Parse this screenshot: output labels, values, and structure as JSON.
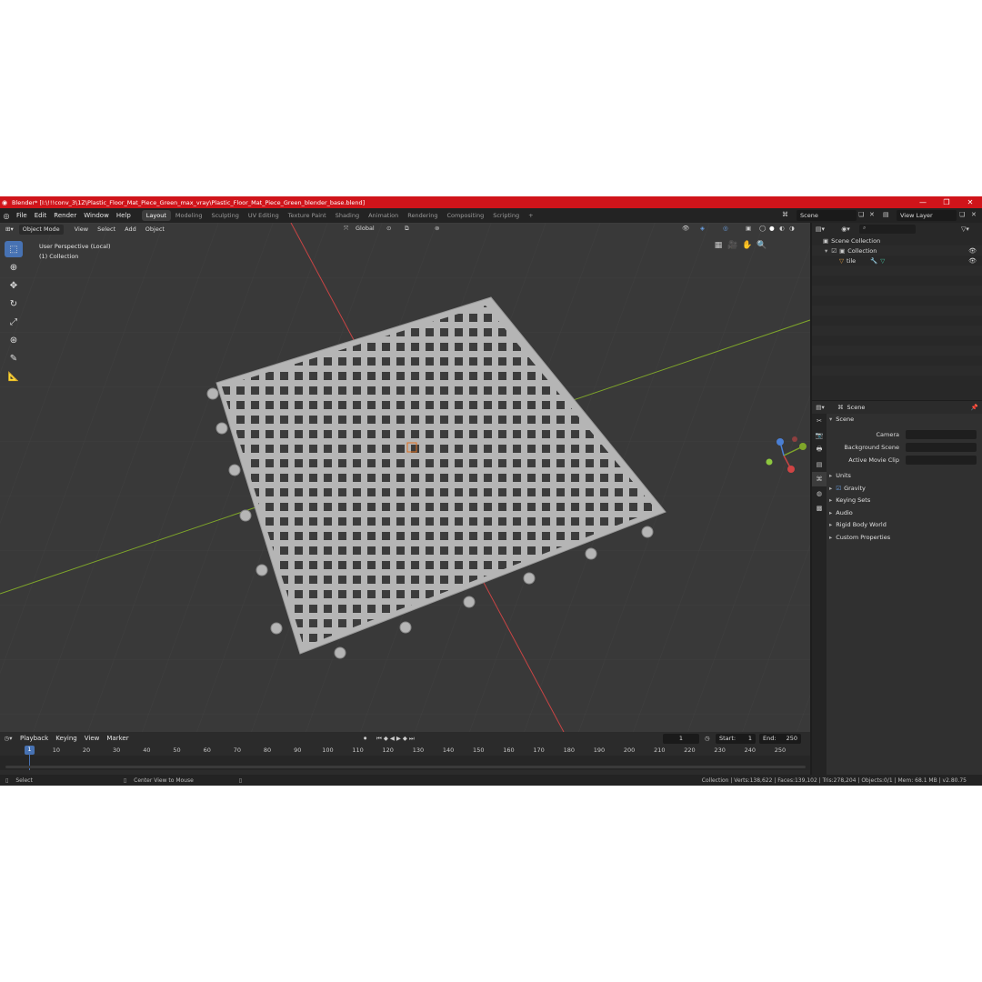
{
  "titlebar": {
    "title": "Blender* [I:\\!!!conv_3\\1Z\\Plastic_Floor_Mat_Piece_Green_max_vray\\Plastic_Floor_Mat_Piece_Green_blender_base.blend]",
    "minimize": "—",
    "maximize": "❐",
    "close": "✕"
  },
  "menu": [
    "File",
    "Edit",
    "Render",
    "Window",
    "Help"
  ],
  "workspaces": [
    "Layout",
    "Modeling",
    "Sculpting",
    "UV Editing",
    "Texture Paint",
    "Shading",
    "Animation",
    "Rendering",
    "Compositing",
    "Scripting"
  ],
  "add_workspace": "+",
  "scene_name": "Scene",
  "view_layer": "View Layer",
  "viewport": {
    "mode": "Object Mode",
    "menus": [
      "View",
      "Select",
      "Add",
      "Object"
    ],
    "transform": "Global",
    "perspective": "User Perspective (Local)",
    "collection": "(1) Collection"
  },
  "timeline": {
    "menus": [
      "Playback",
      "Keying",
      "View",
      "Marker"
    ],
    "current_frame": "1",
    "start_label": "Start:",
    "start": "1",
    "end_label": "End:",
    "end": "250",
    "ticks": [
      "1",
      "10",
      "20",
      "30",
      "40",
      "50",
      "60",
      "70",
      "80",
      "90",
      "100",
      "110",
      "120",
      "130",
      "140",
      "150",
      "160",
      "170",
      "180",
      "190",
      "200",
      "210",
      "220",
      "230",
      "240",
      "250"
    ]
  },
  "statusbar": {
    "select": "Select",
    "center": "Center View to Mouse",
    "stats": "Collection | Verts:138,622 | Faces:139,102 | Tris:278,204 | Objects:0/1 | Mem: 68.1 MB | v2.80.75"
  },
  "outliner": {
    "root": "Scene Collection",
    "collection": "Collection",
    "object": "tile"
  },
  "properties": {
    "context": "Scene",
    "panel": "Scene",
    "camera_label": "Camera",
    "bg_label": "Background Scene",
    "clip_label": "Active Movie Clip",
    "subpanels": [
      "Units",
      "Gravity",
      "Keying Sets",
      "Audio",
      "Rigid Body World",
      "Custom Properties"
    ]
  },
  "colors": {
    "titlebar": "#d0141a",
    "accent": "#4772b3",
    "viewport_bg": "#393939",
    "mesh": "#b5b5b5",
    "x_axis": "#c84444",
    "y_axis": "#7fa62a"
  }
}
